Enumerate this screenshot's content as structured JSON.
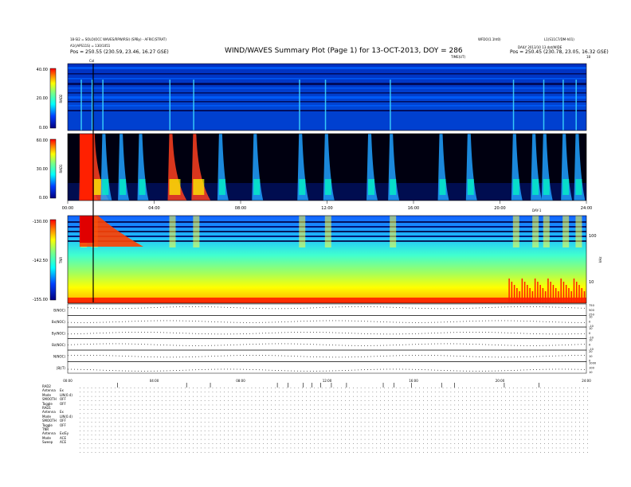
{
  "header": {
    "title": "WIND/WAVES Summary Plot (Page 1) for 13-OCT-2013, DOY = 286",
    "left_line1": "18-SI2 = SOLO(OCC WAVES/RPW/RSI) (SPBy) - AFRIC(STRAT)",
    "left_line2": "A1((APS11S) = 130/1051",
    "left_line3": "Pos = 250.55 (230.59, 23.46, 16.27 GSE)",
    "right_top": "WFDO(1.1ht0)",
    "right_top2": "L1(S11C7/DM-h01)",
    "right_line1": "DAILY 2013/10 13.dat/WIDE",
    "right_line2": "Pos = 250.45 (230.78, 23.05, 16.32 GSE)",
    "time_units_label": "TIME(UT)",
    "small_marker_left": "CxI",
    "small_marker_right": "18"
  },
  "colors": {
    "spectrum_low": "#0000a0",
    "spectrum_mid": "#00ffff",
    "spectrum_high": "#ffff00",
    "spectrum_max": "#ff0000",
    "axis": "#000000"
  },
  "chart_data": [
    {
      "type": "heatmap",
      "panel": "RAD2",
      "ylabel": "RAD2",
      "colorbar_ticks": [
        "40.00",
        "20.00",
        "0.00"
      ],
      "colorbar_range": [
        0,
        40
      ],
      "bursts_hours": [
        0.6,
        1.1,
        1.6,
        4.7,
        5.8,
        10.7,
        11.9,
        14.9,
        20.6,
        22.0,
        22.9,
        23.5
      ]
    },
    {
      "type": "heatmap",
      "panel": "RAD1",
      "ylabel": "RAD1",
      "colorbar_ticks": [
        "60.00",
        "30.00",
        "0.00"
      ],
      "colorbar_range": [
        0,
        60
      ],
      "x_tick_labels": [
        "00:00",
        "04:00",
        "08:00",
        "12:00",
        "16:00",
        "20:00",
        "24:00"
      ],
      "bursts_hours": [
        0.6,
        1.1,
        1.6,
        2.4,
        3.3,
        4.7,
        5.8,
        7.0,
        8.6,
        10.7,
        11.9,
        13.9,
        14.9,
        17.2,
        18.5,
        20.6,
        21.5,
        22.0,
        22.9,
        23.5
      ]
    },
    {
      "type": "heatmap",
      "panel": "TNR",
      "ylabel": "TNR",
      "colorbar_ticks": [
        "-130.00",
        "-142.50",
        "-155.00"
      ],
      "colorbar_range": [
        -155,
        -130
      ],
      "right_axis_ticks": [
        "100",
        "10"
      ],
      "right_axis_label": "kHz",
      "x_tick_labels_header": "DAY-1",
      "bursts_hours": [
        0.6,
        1.1,
        4.7,
        5.8,
        10.7,
        11.9,
        14.9,
        20.6,
        21.5,
        22.0,
        22.9,
        23.5
      ]
    },
    {
      "type": "line",
      "panel": "parameters",
      "series": [
        {
          "name": "B(NOC)",
          "right_ticks": [
            "750",
            "500",
            "250"
          ]
        },
        {
          "name": "Bx(NOC)",
          "right_ticks": [
            "10",
            "0",
            "-10"
          ]
        },
        {
          "name": "By(NOC)",
          "right_ticks": [
            "10",
            "0",
            "-10"
          ]
        },
        {
          "name": "Bz(NOC)",
          "right_ticks": [
            "10",
            "0",
            "-10"
          ]
        },
        {
          "name": "N(NOC)",
          "right_ticks": [
            "20",
            "10",
            "0"
          ]
        },
        {
          "name": "|B|(T)",
          "right_ticks": [
            "1000",
            "100",
            "10"
          ]
        }
      ],
      "x_tick_labels": [
        "00:00",
        "04:00",
        "08:00",
        "12:00",
        "16:00",
        "20:00",
        "24:00"
      ]
    }
  ],
  "status": {
    "groups": [
      {
        "name": "RAD2",
        "rows": [
          [
            "Antenna",
            "Ex"
          ],
          [
            "Mode",
            "LIN(0.4)"
          ],
          [
            "SMOOTH",
            "OFF"
          ],
          [
            "Toggle",
            "OFF"
          ]
        ]
      },
      {
        "name": "RAD1",
        "rows": [
          [
            "Antenna",
            "Ex"
          ],
          [
            "Mode",
            "LIN(0.4)"
          ],
          [
            "SMOOTH",
            "OFF"
          ],
          [
            "Toggle",
            "OFF"
          ]
        ]
      },
      {
        "name": "TNR",
        "rows": [
          [
            "Antenna",
            "Ex/Ey"
          ],
          [
            "Mode",
            "ACE"
          ],
          [
            "Sweep",
            "ACE"
          ]
        ]
      }
    ]
  }
}
